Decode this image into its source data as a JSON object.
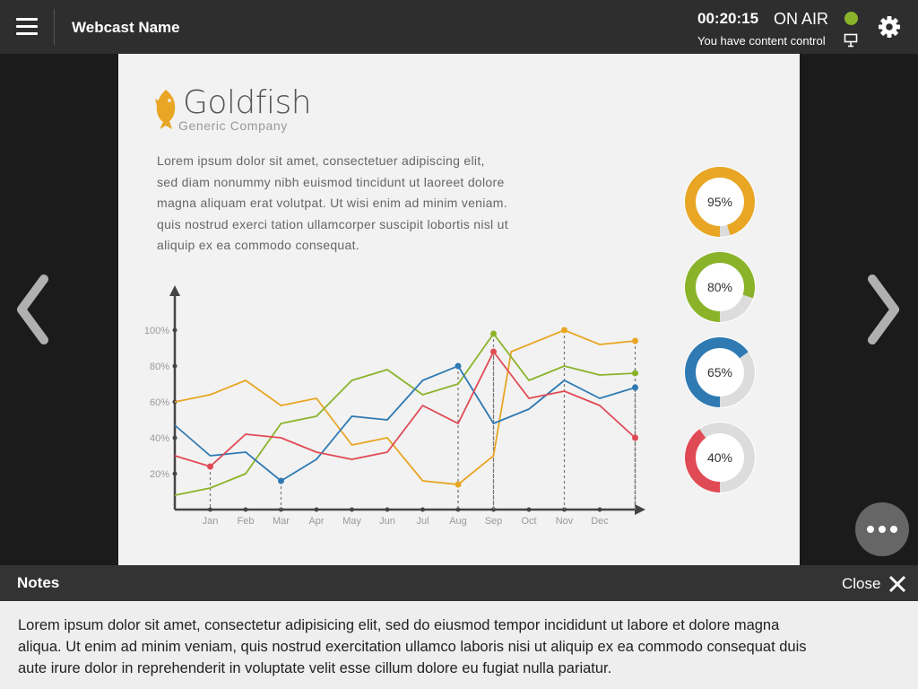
{
  "header": {
    "title": "Webcast Name",
    "timer": "00:20:15",
    "status": "ON AIR",
    "status_color": "#8ab32a",
    "control_text": "You have content control",
    "icons": [
      "menu-icon",
      "presenter-screen-icon",
      "gear-icon"
    ]
  },
  "slide": {
    "logo_name": "Goldfish",
    "logo_subtitle": "Generic Company",
    "body_lines": [
      "Lorem ipsum dolor sit amet, consectetuer adipiscing elit,",
      "sed diam nonummy nibh euismod tincidunt ut laoreet dolore",
      "magna aliquam erat volutpat. Ut wisi enim ad minim veniam.",
      "quis nostrud exerci tation ullamcorper suscipit lobortis nisl ut",
      "aliquip ex ea commodo consequat."
    ]
  },
  "chart_data": [
    {
      "type": "line",
      "categories": [
        "Jan",
        "Feb",
        "Mar",
        "Apr",
        "May",
        "Jun",
        "Jul",
        "Aug",
        "Sep",
        "Oct",
        "Nov",
        "Dec"
      ],
      "x": [
        0,
        1,
        2,
        3,
        4,
        5,
        6,
        7,
        8,
        9,
        10,
        11,
        12
      ],
      "x_tick_labels": [
        "",
        "Jan",
        "Feb",
        "Mar",
        "Apr",
        "May",
        "Jun",
        "Jul",
        "Aug",
        "Sep",
        "Oct",
        "Nov",
        "Dec"
      ],
      "y_ticks": [
        "20%",
        "40%",
        "60%",
        "80%",
        "100%"
      ],
      "ylim": [
        0,
        120
      ],
      "grid": false,
      "series": [
        {
          "color": "#e8a624",
          "values": [
            60,
            64,
            72,
            58,
            62,
            36,
            40,
            16,
            14,
            30,
            88,
            100,
            92,
            94
          ],
          "x": [
            0,
            1,
            2,
            3,
            4,
            5,
            6,
            7,
            8,
            9,
            9.5,
            11,
            12,
            13
          ],
          "highlight": [
            8,
            11,
            13
          ]
        },
        {
          "color": "#8ab32a",
          "values": [
            8,
            12,
            20,
            48,
            52,
            72,
            78,
            64,
            70,
            98,
            72,
            80,
            75,
            76
          ],
          "x": [
            0,
            1,
            2,
            3,
            4,
            5,
            6,
            7,
            8,
            9,
            10,
            11,
            12,
            13
          ],
          "highlight": [
            9,
            13
          ]
        },
        {
          "color": "#2f7ab3",
          "values": [
            47,
            30,
            32,
            16,
            28,
            52,
            50,
            72,
            80,
            48,
            56,
            72,
            62,
            68
          ],
          "x": [
            0,
            1,
            2,
            3,
            4,
            5,
            6,
            7,
            8,
            9,
            10,
            11,
            12,
            13
          ],
          "highlight": [
            3,
            8,
            13
          ]
        },
        {
          "color": "#e04a54",
          "values": [
            30,
            24,
            42,
            40,
            32,
            28,
            32,
            58,
            48,
            88,
            62,
            66,
            58,
            40
          ],
          "x": [
            0,
            1,
            2,
            3,
            4,
            5,
            6,
            7,
            8,
            9,
            10,
            11,
            12,
            13
          ],
          "highlight": [
            1,
            9,
            13
          ]
        }
      ]
    },
    {
      "type": "pie",
      "title": "",
      "values": [
        95,
        80,
        65,
        40
      ],
      "labels": [
        "95%",
        "80%",
        "65%",
        "40%"
      ],
      "colors": [
        "#e8a624",
        "#8ab32a",
        "#2f7ab3",
        "#e04a54"
      ]
    }
  ],
  "notes": {
    "title": "Notes",
    "close_label": "Close",
    "lines": [
      "Lorem ipsum dolor sit amet, consectetur adipisicing elit, sed do eiusmod tempor incididunt ut labore et dolore magna",
      "aliqua. Ut enim ad minim veniam, quis nostrud exercitation ullamco laboris nisi ut aliquip ex ea commodo consequat duis",
      "aute irure dolor in reprehenderit in voluptate velit esse cillum dolore eu fugiat nulla pariatur."
    ]
  }
}
